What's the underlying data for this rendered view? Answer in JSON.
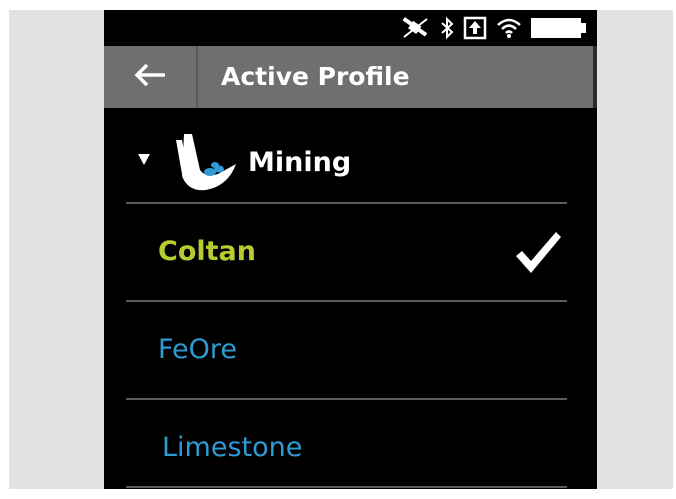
{
  "header": {
    "title": "Active Profile",
    "back_icon": "arrow-left-icon"
  },
  "status_bar": {
    "icons": [
      "gps-off-icon",
      "bluetooth-icon",
      "upload-box-icon",
      "wifi-icon",
      "battery-full-icon"
    ]
  },
  "category": {
    "label": "Mining",
    "expanded": true,
    "icon": "mining-excavator-icon"
  },
  "items": [
    {
      "label": "Coltan",
      "selected": true,
      "color": "#b8cc2f"
    },
    {
      "label": "FeOre",
      "selected": false,
      "color": "#2e9bd3"
    },
    {
      "label": "Limestone",
      "selected": false,
      "color": "#2e9bd3"
    }
  ],
  "colors": {
    "header_bg": "#6f6f6f",
    "screen_bg": "#000000",
    "selected_text": "#b8cc2f",
    "item_text": "#2e9bd3",
    "divider": "#5c5c5c"
  }
}
